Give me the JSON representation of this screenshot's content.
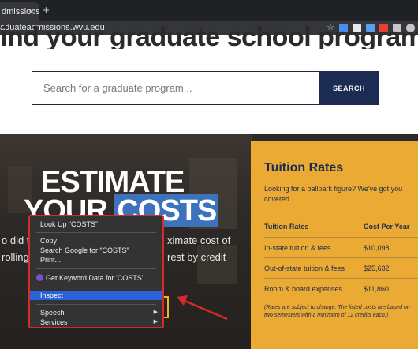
{
  "browser": {
    "tab_title": "dmissions",
    "tab_close": "✕",
    "new_tab": "+",
    "url": "aduateadmissions.wvu.edu",
    "star": "☆",
    "toolbar_icon_colors": [
      "#4a8cf0",
      "#e8eaed",
      "#5aa0f0",
      "#e94235",
      "#c6c6c6",
      "#c6c6c6"
    ]
  },
  "hero": {
    "heading": "ind your graduate school program."
  },
  "search": {
    "placeholder": "Search for a graduate program...",
    "button_label": "SEARCH"
  },
  "estimate": {
    "line1": "ESTIMATE",
    "line2_prefix": "YOUR",
    "line2_highlight": "COSTS",
    "body_left_1": "o did the",
    "body_right_1": "ximate cost of",
    "body_left_2": "rolling",
    "body_right_2": "rest by credit"
  },
  "tuition": {
    "title": "Tuition Rates",
    "intro": "Looking for a ballpark figure? We've got you covered.",
    "header": {
      "label": "Tuition Rates",
      "value": "Cost Per Year"
    },
    "rows": [
      {
        "label": "In-state tuition & fees",
        "value": "$10,098"
      },
      {
        "label": "Out-of-state tuition & fees",
        "value": "$25,632"
      },
      {
        "label": "Room & board expenses",
        "value": "$11,860"
      }
    ],
    "note": "(Rates are subject to change. The listed costs are based on two semesters with a minimum of 12 credits each.)"
  },
  "context_menu": {
    "look_up": "Look Up “COSTS”",
    "copy": "Copy",
    "search_google": "Search Google for “COSTS”",
    "print": "Print...",
    "keyword": "Get Keyword Data for 'COSTS'",
    "inspect": "Inspect",
    "speech": "Speech",
    "services": "Services",
    "submenu_arrow": "▶"
  },
  "colors": {
    "navy": "#1b2c52",
    "gold": "#eaaa33",
    "highlight_blue": "#3d73bd",
    "menu_highlight": "#2c62d8",
    "annotation_red": "#d62a2a"
  }
}
